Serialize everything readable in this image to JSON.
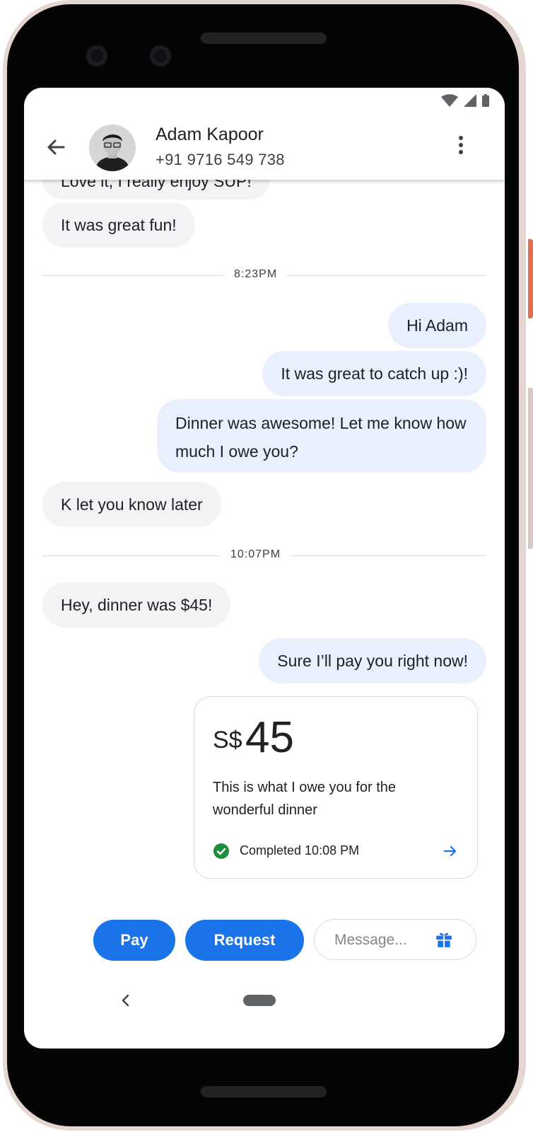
{
  "contact": {
    "name": "Adam Kapoor",
    "phone": "+91 9716 549 738"
  },
  "messages": [
    {
      "dir": "in",
      "text": "Love it, I really enjoy SUP!"
    },
    {
      "dir": "in",
      "text": "It was great fun!"
    },
    {
      "dir": "out",
      "text": "Hi Adam"
    },
    {
      "dir": "out",
      "text": "It was great to catch up :)!"
    },
    {
      "dir": "out",
      "text": "Dinner was awesome! Let me know how much I owe you?"
    },
    {
      "dir": "in",
      "text": "K let you know later"
    },
    {
      "dir": "in",
      "text": "Hey, dinner was $45!"
    },
    {
      "dir": "out",
      "text": "Sure I’ll pay you right now!"
    }
  ],
  "timestamps": [
    "8:23PM",
    "10:07PM"
  ],
  "payment": {
    "currency": "S$",
    "amount": "45",
    "note": "This is what I owe you for the wonderful dinner",
    "status": "Completed 10:08 PM"
  },
  "actions": {
    "pay_label": "Pay",
    "request_label": "Request",
    "message_placeholder": "Message..."
  },
  "colors": {
    "accent": "#1a73e8",
    "incoming_bubble": "#f1f3f4",
    "outgoing_bubble": "#e8f0fe",
    "completed_green": "#1e8e3e"
  }
}
